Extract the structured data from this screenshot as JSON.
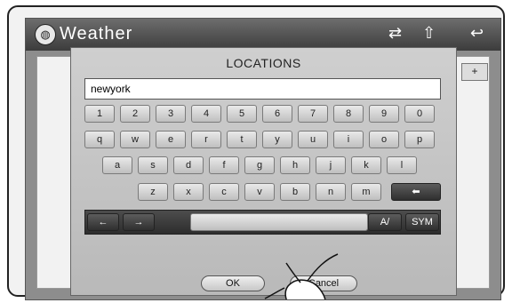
{
  "topbar": {
    "app_icon": "globe-icon",
    "title": "Weather",
    "icons": [
      "swap-icon",
      "up-arrow-icon",
      "back-icon"
    ]
  },
  "background": {
    "plus": "+"
  },
  "dialog": {
    "title": "LOCATIONS",
    "input_value": "newyork",
    "rows": [
      [
        "1",
        "2",
        "3",
        "4",
        "5",
        "6",
        "7",
        "8",
        "9",
        "0"
      ],
      [
        "q",
        "w",
        "e",
        "r",
        "t",
        "y",
        "u",
        "i",
        "o",
        "p"
      ],
      [
        "a",
        "s",
        "d",
        "f",
        "g",
        "h",
        "j",
        "k",
        "l"
      ],
      [
        "z",
        "x",
        "c",
        "v",
        "b",
        "n",
        "m"
      ]
    ],
    "backspace_icon": "backspace-icon",
    "left_arrow": "←",
    "right_arrow": "→",
    "space_hint": "",
    "mode_label": "A/",
    "sym_label": "SYM",
    "ok_label": "OK",
    "cancel_label": "Cancel"
  }
}
